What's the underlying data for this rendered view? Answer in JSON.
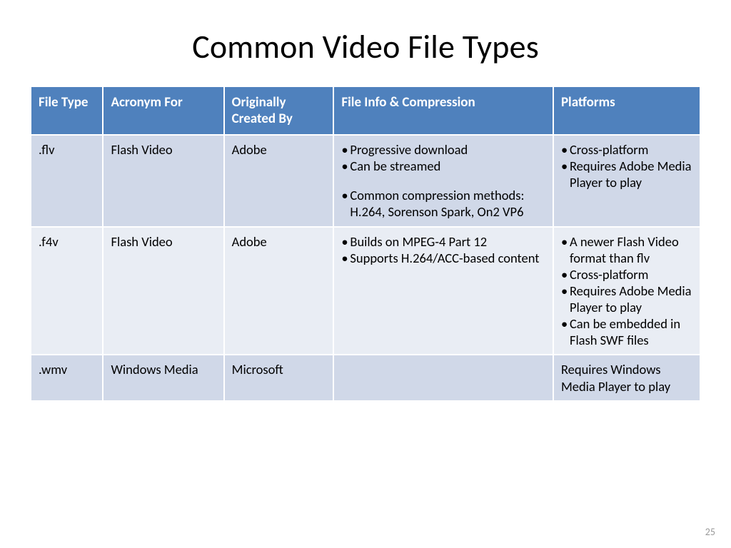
{
  "title": "Common Video File Types",
  "page_number": "25",
  "columns": [
    "File Type",
    "Acronym For",
    "Originally Created By",
    "File Info & Compression",
    "Platforms"
  ],
  "rows": [
    {
      "file_type": ".flv",
      "acronym_for": "Flash Video",
      "created_by": "Adobe",
      "info": [
        "Progressive download",
        "Can be streamed",
        "Common compression methods: H.264, Sorenson Spark, On2 VP6"
      ],
      "info_gap_before_index": 2,
      "platforms": [
        "Cross-platform",
        "Requires Adobe Media Player to play"
      ],
      "platforms_bulleted": true
    },
    {
      "file_type": ".f4v",
      "acronym_for": "Flash Video",
      "created_by": "Adobe",
      "info": [
        "Builds on MPEG-4 Part 12",
        "Supports H.264/ACC-based content"
      ],
      "info_gap_before_index": -1,
      "platforms": [
        "A newer Flash Video format than flv",
        "Cross-platform",
        "Requires Adobe Media Player to play",
        "Can be embedded in Flash SWF files"
      ],
      "platforms_bulleted": true
    },
    {
      "file_type": ".wmv",
      "acronym_for": "Windows Media",
      "created_by": "Microsoft",
      "info": [],
      "info_gap_before_index": -1,
      "platforms": [
        "Requires Windows Media Player to play"
      ],
      "platforms_bulleted": false
    }
  ]
}
